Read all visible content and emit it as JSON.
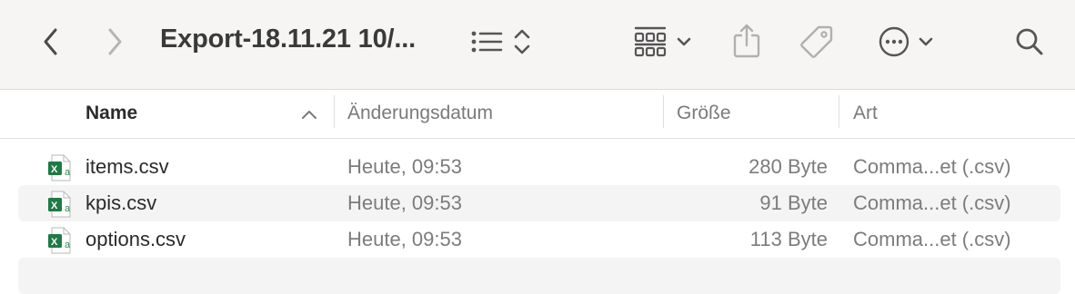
{
  "toolbar": {
    "title": "Export-18.11.21 10/...",
    "back_icon": "chevron-left-icon",
    "forward_icon": "chevron-right-icon",
    "list_view_icon": "list-view-icon",
    "sort_icon": "up-down-chevron-icon",
    "group_icon": "grid-group-icon",
    "share_icon": "share-icon",
    "tag_icon": "tag-icon",
    "more_icon": "ellipsis-circle-icon",
    "search_icon": "search-icon"
  },
  "columns": {
    "name": "Name",
    "modified": "Änderungsdatum",
    "size": "Größe",
    "kind": "Art"
  },
  "files": [
    {
      "name": "items.csv",
      "modified": "Heute, 09:53",
      "size": "280 Byte",
      "kind": "Comma...et (.csv)",
      "icon": "excel-csv-file-icon"
    },
    {
      "name": "kpis.csv",
      "modified": "Heute, 09:53",
      "size": "91 Byte",
      "kind": "Comma...et (.csv)",
      "icon": "excel-csv-file-icon"
    },
    {
      "name": "options.csv",
      "modified": "Heute, 09:53",
      "size": "113 Byte",
      "kind": "Comma...et (.csv)",
      "icon": "excel-csv-file-icon"
    }
  ],
  "colors": {
    "toolbar_bg": "#f6f5f4",
    "alt_row_bg": "#f4f4f4",
    "excel_green": "#1f7a45"
  }
}
